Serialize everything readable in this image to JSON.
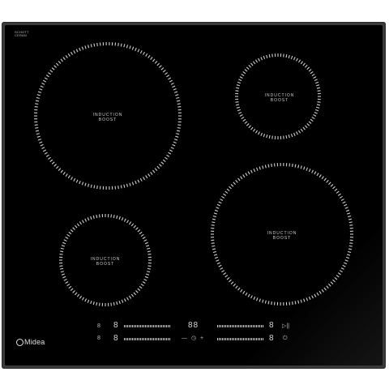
{
  "brand_mark": {
    "line1": "SCHOTT",
    "line2": "CERAN"
  },
  "zones": [
    {
      "id": "front-left-large",
      "label_line1": "INDUCTION",
      "label_line2": "BOOST"
    },
    {
      "id": "rear-right-small",
      "label_line1": "INDUCTION",
      "label_line2": "BOOST"
    },
    {
      "id": "rear-left-small",
      "label_line1": "INDUCTION",
      "label_line2": "BOOST"
    },
    {
      "id": "front-right-large",
      "label_line1": "INDUCTION",
      "label_line2": "BOOST"
    }
  ],
  "controls": {
    "left_top_digit": "8",
    "left_bottom_digit": "8",
    "left_top_marker": "8",
    "left_bottom_marker": "8",
    "center_display": "88",
    "center_minus": "—",
    "center_timer": "◷",
    "center_plus": "+",
    "right_top_digit": "8",
    "right_bottom_digit": "8",
    "right_top_icon": "▷||",
    "right_bottom_icon": "⏻"
  },
  "logo": {
    "text": "Midea"
  },
  "colors": {
    "glass": "#000000",
    "frame": "#3a3a3a",
    "print": "#cfcfcf"
  }
}
